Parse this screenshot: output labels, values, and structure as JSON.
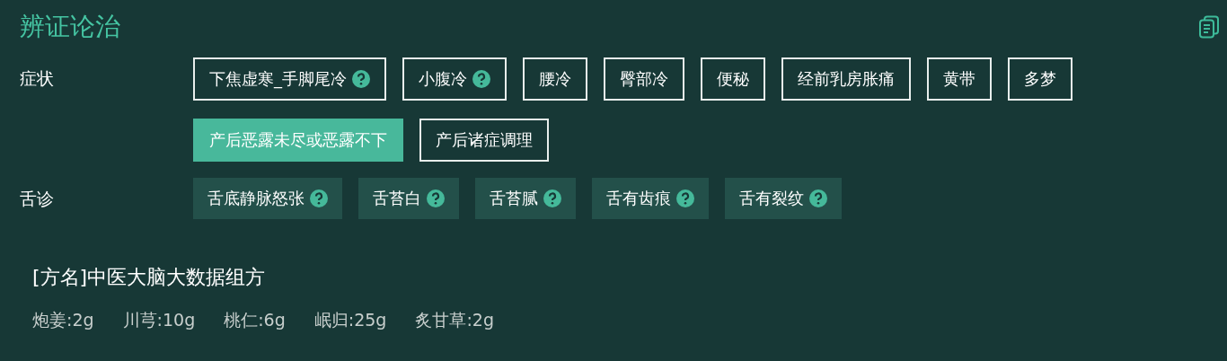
{
  "panel": {
    "title": "辨证论治"
  },
  "sections": [
    {
      "label": "症状",
      "kind": "outline",
      "tags": [
        {
          "text": "下焦虚寒_手脚尾冷",
          "help": true,
          "selected": false
        },
        {
          "text": "小腹冷",
          "help": true,
          "selected": false
        },
        {
          "text": "腰冷",
          "help": false,
          "selected": false
        },
        {
          "text": "臀部冷",
          "help": false,
          "selected": false
        },
        {
          "text": "便秘",
          "help": false,
          "selected": false
        },
        {
          "text": "经前乳房胀痛",
          "help": false,
          "selected": false
        },
        {
          "text": "黄带",
          "help": false,
          "selected": false
        },
        {
          "text": "多梦",
          "help": false,
          "selected": false
        },
        {
          "text": "产后恶露未尽或恶露不下",
          "help": false,
          "selected": true
        },
        {
          "text": "产后诸症调理",
          "help": false,
          "selected": false
        }
      ]
    },
    {
      "label": "舌诊",
      "kind": "filled",
      "tags": [
        {
          "text": "舌底静脉怒张",
          "help": true,
          "selected": false
        },
        {
          "text": "舌苔白",
          "help": true,
          "selected": false
        },
        {
          "text": "舌苔腻",
          "help": true,
          "selected": false
        },
        {
          "text": "舌有齿痕",
          "help": true,
          "selected": false
        },
        {
          "text": "舌有裂纹",
          "help": true,
          "selected": false
        }
      ]
    }
  ],
  "formula": {
    "name": "[方名]中医大脑大数据组方",
    "herbs": [
      "炮姜:2g",
      "川芎:10g",
      "桃仁:6g",
      "岷归:25g",
      "炙甘草:2g"
    ]
  }
}
